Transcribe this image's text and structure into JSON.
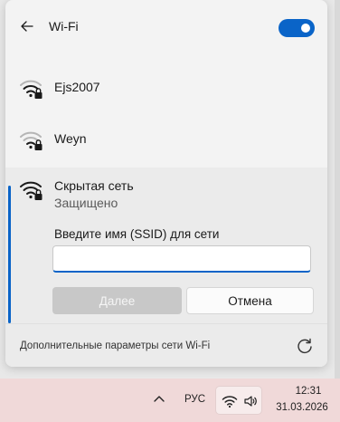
{
  "header": {
    "title": "Wi-Fi",
    "toggle_on": true,
    "accent_color": "#0a64c8"
  },
  "networks": [
    {
      "name": "Ejs2007",
      "icon": "wifi-secured-icon"
    },
    {
      "name": "Weyn",
      "icon": "wifi-secured-icon"
    }
  ],
  "hidden_network": {
    "name": "Скрытая сеть",
    "status": "Защищено",
    "ssid_label": "Введите имя (SSID) для сети",
    "ssid_value": "",
    "next_label": "Далее",
    "cancel_label": "Отмена"
  },
  "footer": {
    "settings_link": "Дополнительные параметры сети Wi-Fi",
    "refresh_icon": "refresh-icon"
  },
  "taskbar": {
    "language": "РУС",
    "time": "12:31",
    "date": "31.03.2026",
    "background_color": "#f0d9d9"
  }
}
